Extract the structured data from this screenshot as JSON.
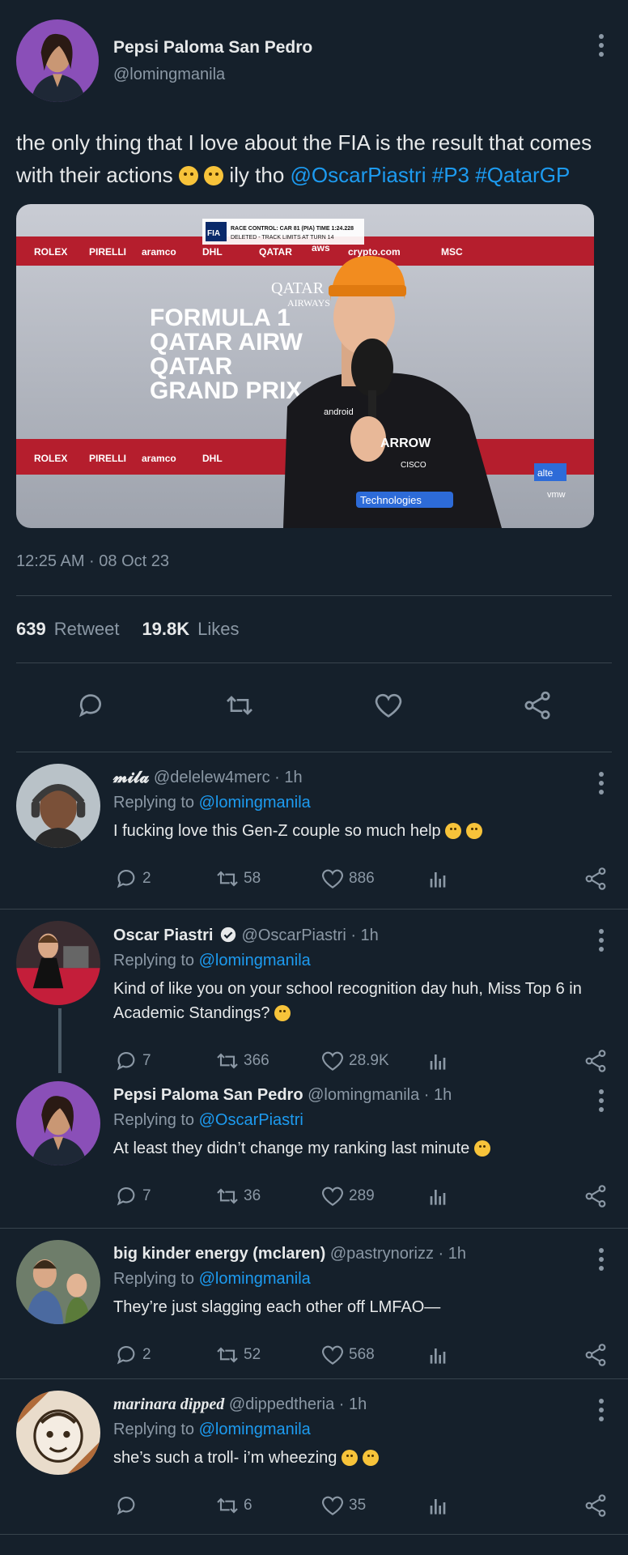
{
  "main_tweet": {
    "author_name": "Pepsi Paloma San Pedro",
    "author_handle": "@lomingmanila",
    "text_part1": "the only thing that I love about the FIA is the result that comes with their actions",
    "text_part2": "ily tho",
    "mention": "@OscarPiastri",
    "hashtag1": "#P3",
    "hashtag2": "#QatarGP",
    "timestamp": "12:25 AM · 08 Oct 23",
    "retweet_count": "639",
    "retweet_label": "Retweet",
    "like_count": "19.8K",
    "like_label": "Likes",
    "image_text": {
      "race_control": "RACE CONTROL: CAR 81 (PIA) TIME 1:24.228",
      "race_control_2": "DELETED - TRACK LIMITS AT TURN 14",
      "f1_line1": "FORMULA 1",
      "f1_line2": "QATAR AIRW",
      "f1_line3": "QATAR",
      "f1_line4": "GRAND PRIX",
      "qatar": "QATAR",
      "airways": "AIRWAYS",
      "rolex": "ROLEX",
      "pirelli": "PIRELLI",
      "aramco": "aramco",
      "dhl": "DHL",
      "aws": "aws",
      "crypto": "crypto.com",
      "msc": "MSC",
      "arrow": "ARROW",
      "cisco": "CISCO",
      "technologies": "Technologies",
      "android": "android",
      "alteryx": "alte",
      "vmware": "vmw",
      "fia": "FIA"
    }
  },
  "replies": [
    {
      "name": "𝓶𝓲𝓵𝓪",
      "handle": "@delelew4merc",
      "time": "1h",
      "replying_label": "Replying to",
      "replying_to": "@lomingmanila",
      "text": "I fucking love this Gen-Z couple so much help",
      "reply_count": "2",
      "retweet_count": "58",
      "like_count": "886"
    },
    {
      "name": "Oscar Piastri",
      "handle": "@OscarPiastri",
      "time": "1h",
      "replying_label": "Replying to",
      "replying_to": "@lomingmanila",
      "text": "Kind of like you on your school recognition day huh, Miss Top 6 in Academic Standings?",
      "reply_count": "7",
      "retweet_count": "366",
      "like_count": "28.9K"
    },
    {
      "name": "Pepsi Paloma San Pedro",
      "handle": "@lomingmanila",
      "time": "1h",
      "replying_label": "Replying to",
      "replying_to": "@OscarPiastri",
      "text": "At least they didn’t change my ranking last minute",
      "reply_count": "7",
      "retweet_count": "36",
      "like_count": "289"
    },
    {
      "name": "big kinder energy (mclaren)",
      "handle": "@pastrynorizz",
      "time": "1h",
      "replying_label": "Replying to",
      "replying_to": "@lomingmanila",
      "text": "They’re just slagging each other off LMFAO—",
      "reply_count": "2",
      "retweet_count": "52",
      "like_count": "568"
    },
    {
      "name": "marinara dipped",
      "handle": "@dippedtheria",
      "time": "1h",
      "replying_label": "Replying to",
      "replying_to": "@lomingmanila",
      "text": "she’s such a troll- i’m wheezing",
      "reply_count": "",
      "retweet_count": "6",
      "like_count": "35"
    }
  ],
  "colors": {
    "background": "#15202b",
    "link": "#1d9bf0",
    "secondary_text": "#8b98a5",
    "divider": "#38444d"
  },
  "icons": {
    "reply": "reply-icon",
    "retweet": "retweet-icon",
    "like": "heart-icon",
    "share": "share-icon",
    "analytics": "analytics-icon",
    "more": "more-icon"
  }
}
